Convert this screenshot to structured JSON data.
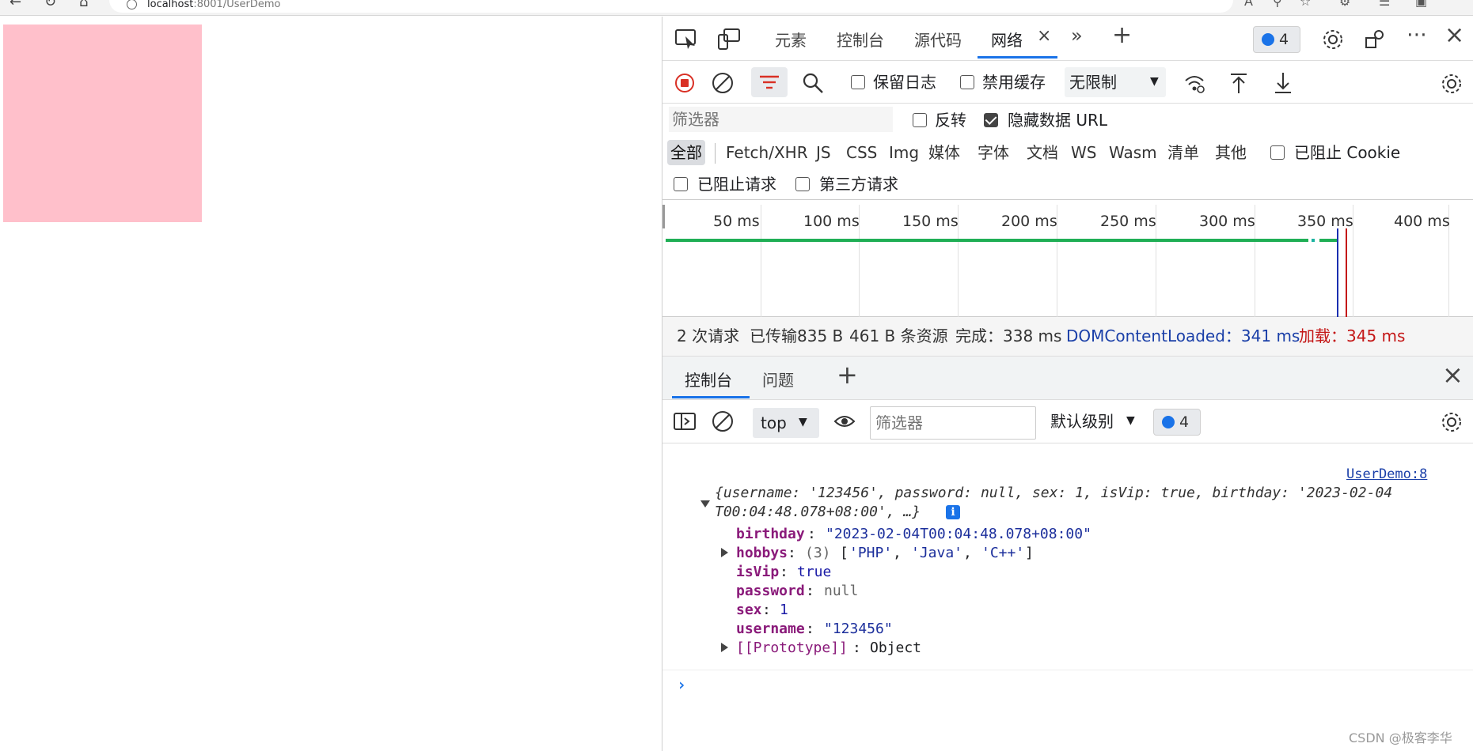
{
  "browser": {
    "url_host": "localhost",
    "url_path": ":8001/UserDemo"
  },
  "devtools": {
    "tabs": [
      "元素",
      "控制台",
      "源代码",
      "网络"
    ],
    "active_tab": "网络",
    "issue_count": "4",
    "network": {
      "preserve_log": "保留日志",
      "disable_cache": "禁用缓存",
      "throttle": "无限制",
      "filter_placeholder": "筛选器",
      "invert": "反转",
      "hide_data_url": "隐藏数据 URL",
      "hide_data_url_checked": true,
      "types": [
        "全部",
        "Fetch/XHR",
        "JS",
        "CSS",
        "Img",
        "媒体",
        "字体",
        "文档",
        "WS",
        "Wasm",
        "清单",
        "其他"
      ],
      "blocked_cookies": "已阻止 Cookie",
      "blocked_requests": "已阻止请求",
      "third_party": "第三方请求",
      "timeline_ticks": [
        "50 ms",
        "100 ms",
        "150 ms",
        "200 ms",
        "250 ms",
        "300 ms",
        "350 ms",
        "400 ms"
      ],
      "summary": {
        "requests": "2 次请求",
        "transferred": "已传输835 B",
        "resources": "461 B 条资源",
        "finish": "完成：338 ms",
        "dcl": "DOMContentLoaded：341 ms",
        "load": "加载：345 ms"
      }
    },
    "drawer": {
      "tabs": [
        "控制台",
        "问题"
      ],
      "context": "top",
      "filter_placeholder": "筛选器",
      "level": "默认级别",
      "message_count": "4"
    },
    "console": {
      "source": "UserDemo:8",
      "summary_line1": "{username: '123456', password: null, sex: 1, isVip: true, birthday: '2023-02-04",
      "summary_line2": "T00:04:48.078+08:00', …}",
      "props": {
        "birthday_key": "birthday",
        "birthday_val": "\"2023-02-04T00:04:48.078+08:00\"",
        "hobbys_key": "hobbys",
        "hobbys_count": "(3)",
        "hobbys_val": [
          "'PHP'",
          "'Java'",
          "'C++'"
        ],
        "isVip_key": "isVip",
        "isVip_val": "true",
        "password_key": "password",
        "password_val": "null",
        "sex_key": "sex",
        "sex_val": "1",
        "username_key": "username",
        "username_val": "\"123456\"",
        "proto_key": "[[Prototype]]",
        "proto_val": "Object"
      }
    }
  },
  "watermark": "CSDN @极客李华"
}
